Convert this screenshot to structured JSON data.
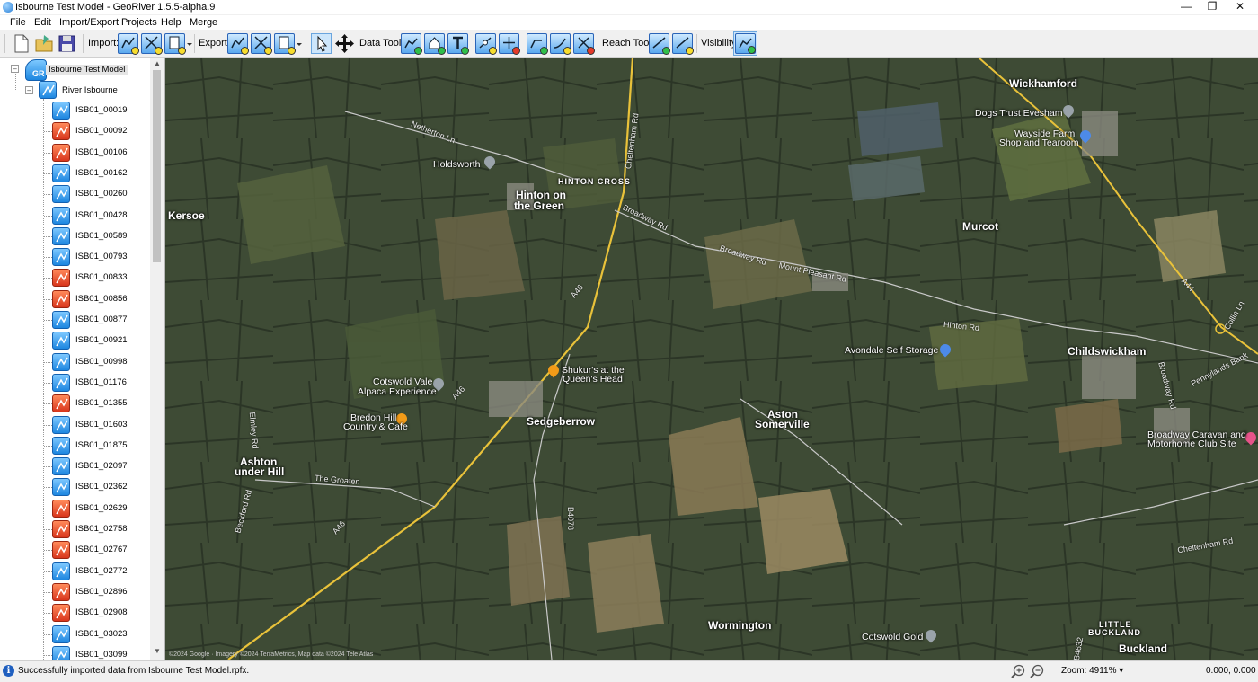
{
  "window": {
    "title": "Isbourne Test Model - GeoRiver 1.5.5-alpha.9"
  },
  "menu": [
    "File",
    "Edit",
    "Import/Export",
    "Projects",
    "Help",
    "Merge"
  ],
  "toolbar": {
    "import_label": "Import:",
    "export_label": "Export:",
    "data_tools_label": "Data Tools:",
    "reach_tools_label": "Reach Tools:",
    "visibility_label": "Visibility:"
  },
  "tree": {
    "root": "Isbourne Test Model",
    "river": "River Isbourne",
    "nodes": [
      {
        "label": "ISB01_00019",
        "status": "blue"
      },
      {
        "label": "ISB01_00092",
        "status": "red"
      },
      {
        "label": "ISB01_00106",
        "status": "red"
      },
      {
        "label": "ISB01_00162",
        "status": "blue"
      },
      {
        "label": "ISB01_00260",
        "status": "blue"
      },
      {
        "label": "ISB01_00428",
        "status": "blue"
      },
      {
        "label": "ISB01_00589",
        "status": "blue"
      },
      {
        "label": "ISB01_00793",
        "status": "blue"
      },
      {
        "label": "ISB01_00833",
        "status": "red"
      },
      {
        "label": "ISB01_00856",
        "status": "red"
      },
      {
        "label": "ISB01_00877",
        "status": "blue"
      },
      {
        "label": "ISB01_00921",
        "status": "blue"
      },
      {
        "label": "ISB01_00998",
        "status": "blue"
      },
      {
        "label": "ISB01_01176",
        "status": "blue"
      },
      {
        "label": "ISB01_01355",
        "status": "red"
      },
      {
        "label": "ISB01_01603",
        "status": "blue"
      },
      {
        "label": "ISB01_01875",
        "status": "blue"
      },
      {
        "label": "ISB01_02097",
        "status": "blue"
      },
      {
        "label": "ISB01_02362",
        "status": "blue"
      },
      {
        "label": "ISB01_02629",
        "status": "red"
      },
      {
        "label": "ISB01_02758",
        "status": "red"
      },
      {
        "label": "ISB01_02767",
        "status": "red"
      },
      {
        "label": "ISB01_02772",
        "status": "blue"
      },
      {
        "label": "ISB01_02896",
        "status": "red"
      },
      {
        "label": "ISB01_02908",
        "status": "red"
      },
      {
        "label": "ISB01_03023",
        "status": "blue"
      },
      {
        "label": "ISB01_03099",
        "status": "blue"
      }
    ]
  },
  "map": {
    "places": {
      "wickhamford": "Wickhamford",
      "dogs_trust": "Dogs Trust Evesham",
      "wayside_1": "Wayside Farm",
      "wayside_2": "Shop and Tearoom",
      "holdsworth": "Holdsworth",
      "hinton_cross": "HINTON CROSS",
      "hinton_1": "Hinton on",
      "hinton_2": "the Green",
      "kersoe": "Kersoe",
      "murcot": "Murcot",
      "avondale": "Avondale Self Storage",
      "childswickham": "Childswickham",
      "shukur_1": "Shukur's at the",
      "shukur_2": "Queen's Head",
      "cotswold_vale_1": "Cotswold Vale",
      "cotswold_vale_2": "Alpaca Experience",
      "bredon_1": "Bredon Hill",
      "bredon_2": "Country & Cafe",
      "sedgeberrow": "Sedgeberrow",
      "aston_1": "Aston",
      "aston_2": "Somerville",
      "ashton_1": "Ashton",
      "ashton_2": "under Hill",
      "broadway_caravan_1": "Broadway Caravan and",
      "broadway_caravan_2": "Motorhome Club Site",
      "wormington": "Wormington",
      "cotswold_gold": "Cotswold Gold",
      "little_buckland_1": "LITTLE",
      "little_buckland_2": "BUCKLAND",
      "buckland": "Buckland"
    },
    "roads": {
      "netherton": "Netherton Ln",
      "cheltenham": "Cheltenham Rd",
      "broadway1": "Broadway Rd",
      "broadway2": "Broadway Rd",
      "mount_pleasant": "Mount Pleasant Rd",
      "hinton_rd": "Hinton Rd",
      "a46a": "A46",
      "a46b": "A46",
      "a46c": "A46",
      "a44": "A44",
      "groaten": "The Groaten",
      "b4078": "B4078",
      "pennylands": "Pennylands Bank",
      "collin": "Collin Ln",
      "cheltenham2": "Cheltenham Rd",
      "elmley": "Elmley Rd",
      "beckford": "Beckford Rd",
      "b4632": "B4632",
      "broadway_rd3": "Broadway Rd"
    },
    "copyright": "©2024 Google · Imagery ©2024 TerraMetrics, Map data ©2024 Tele Atlas"
  },
  "status": {
    "message": "Successfully imported data from Isbourne Test Model.rpfx.",
    "zoom": "Zoom: 4911% ▾",
    "coords": "0.000, 0.000"
  },
  "colors": {
    "accent": "#1d86e0",
    "status_red": "#d8361c",
    "road_yellow": "#e9c23a"
  }
}
